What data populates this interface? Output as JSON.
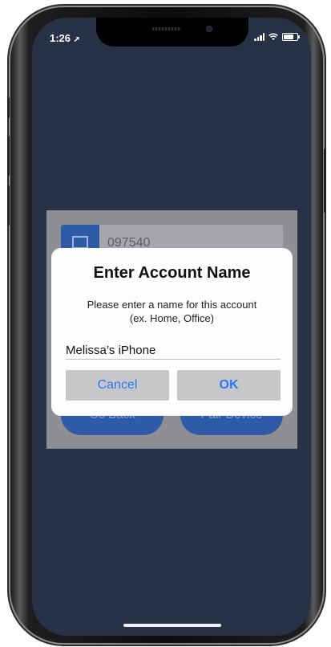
{
  "status_bar": {
    "time": "1:26",
    "location_icon": "location-arrow-icon",
    "signal_icon": "cellular-signal-icon",
    "wifi_icon": "wifi-icon",
    "battery_icon": "battery-icon"
  },
  "background": {
    "code": "097540",
    "go_back_label": "Go Back",
    "pair_device_label": "Pair Device"
  },
  "alert": {
    "title": "Enter Account Name",
    "message_line1": "Please enter a name for this account",
    "message_line2": "(ex. Home, Office)",
    "input_value": "Melissa’s iPhone",
    "cancel_label": "Cancel",
    "ok_label": "OK"
  },
  "colors": {
    "screen_background": "#283247",
    "accent_blue": "#2b78f5",
    "primary_button": "#2f5aa8"
  }
}
